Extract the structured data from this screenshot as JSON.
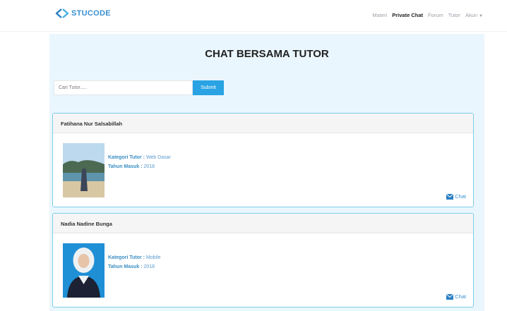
{
  "navbar": {
    "brand": "STUCODE",
    "items": [
      {
        "label": "Materi",
        "active": false
      },
      {
        "label": "Private Chat",
        "active": true
      },
      {
        "label": "Forum",
        "active": false
      },
      {
        "label": "Tutor",
        "active": false
      },
      {
        "label": "Akun",
        "active": false
      }
    ]
  },
  "page": {
    "title": "CHAT BERSAMA TUTOR"
  },
  "search": {
    "placeholder": "Cari Tutor.....",
    "button": "Submit"
  },
  "tutors": [
    {
      "name": "Fatihana Nur Salsabillah",
      "category_label": "Kategori Tutor :",
      "category": "Web Dasar",
      "year_label": "Tahun Masuk :",
      "year": "2018",
      "chat": "Chat"
    },
    {
      "name": "Nadia Nadine Bunga",
      "category_label": "Kategori Tutor :",
      "category": "Mobile",
      "year_label": "Tahun Masuk :",
      "year": "2018",
      "chat": "Chat"
    }
  ],
  "colors": {
    "accent": "#29a3e3",
    "card_border": "#7ecde8",
    "background": "#eaf6fd"
  }
}
